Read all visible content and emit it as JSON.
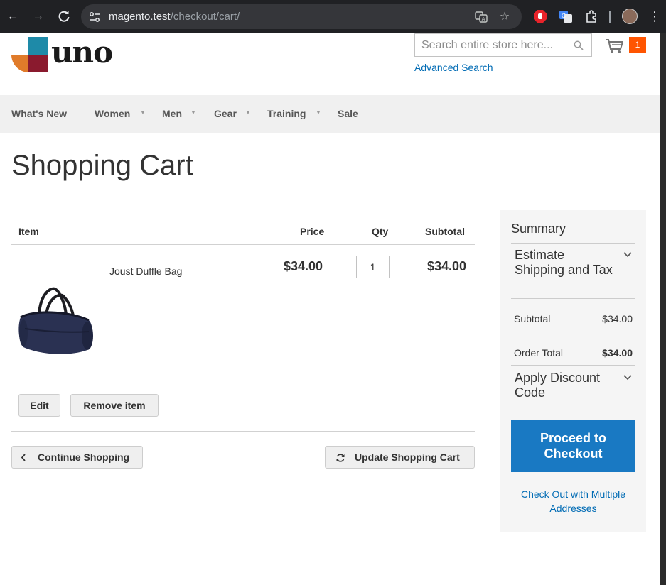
{
  "browser": {
    "url_host": "magento.test",
    "url_path": "/checkout/cart/"
  },
  "header": {
    "logo_text": "uno",
    "search": {
      "placeholder": "Search entire store here..."
    },
    "advanced_search_label": "Advanced Search",
    "cart_count": "1"
  },
  "nav": {
    "items": [
      {
        "label": "What's New",
        "has_submenu": false
      },
      {
        "label": "Women",
        "has_submenu": true
      },
      {
        "label": "Men",
        "has_submenu": true
      },
      {
        "label": "Gear",
        "has_submenu": true
      },
      {
        "label": "Training",
        "has_submenu": true
      },
      {
        "label": "Sale",
        "has_submenu": false
      }
    ]
  },
  "page": {
    "title": "Shopping Cart"
  },
  "cart": {
    "columns": [
      "Item",
      "Price",
      "Qty",
      "Subtotal"
    ],
    "items": [
      {
        "name": "Joust Duffle Bag",
        "price": "$34.00",
        "qty": "1",
        "subtotal": "$34.00"
      }
    ],
    "edit_label": "Edit",
    "remove_label": "Remove item",
    "continue_label": "Continue Shopping",
    "update_label": "Update Shopping Cart"
  },
  "summary": {
    "title": "Summary",
    "estimate_title": "Estimate Shipping and Tax",
    "subtotal_label": "Subtotal",
    "subtotal_value": "$34.00",
    "order_total_label": "Order Total",
    "order_total_value": "$34.00",
    "discount_title": "Apply Discount Code",
    "checkout_label": "Proceed to Checkout",
    "multi_address_label": "Check Out with Multiple Addresses"
  },
  "colors": {
    "primary": "#1979c3",
    "link": "#006bb4",
    "badge": "#ff5501",
    "nav_bg": "#f0f0f0",
    "summary_bg": "#f5f5f5"
  }
}
